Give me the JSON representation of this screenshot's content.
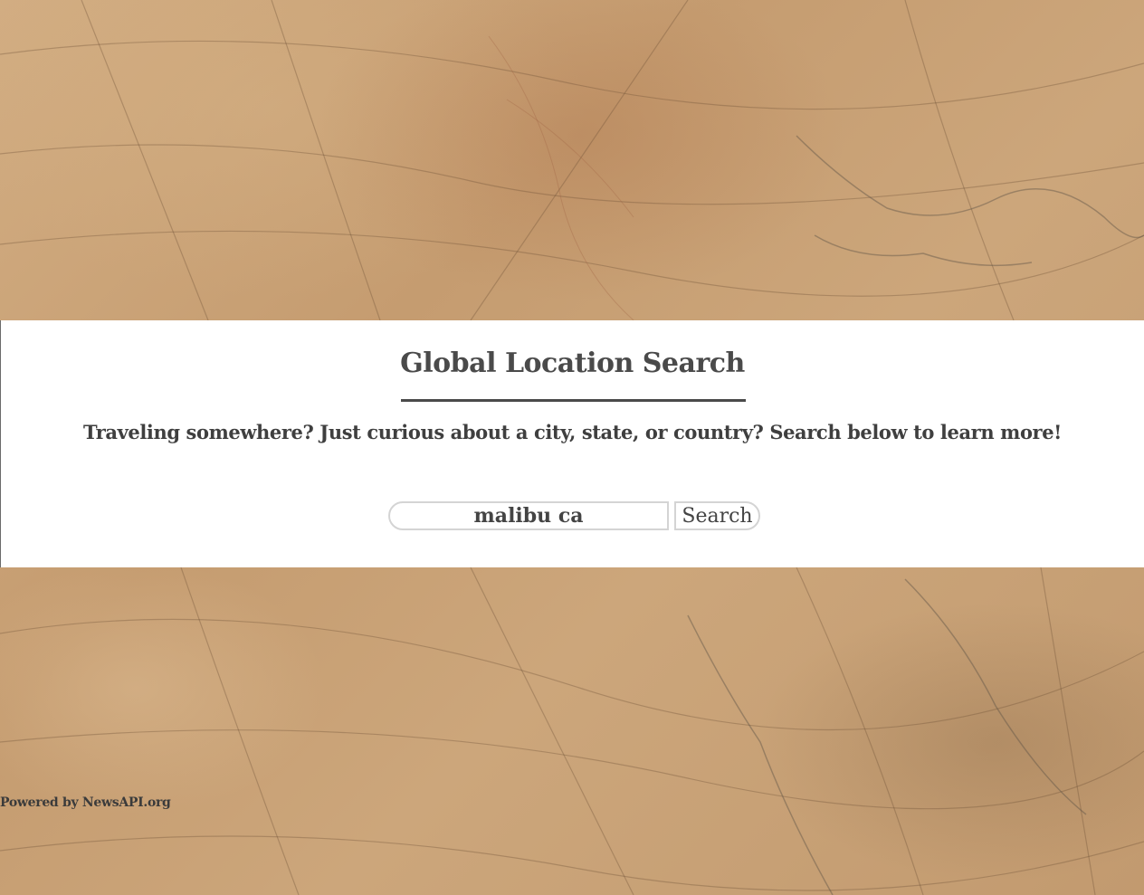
{
  "header": {
    "title": "Global Location Search",
    "subtitle": "Traveling somewhere? Just curious about a city, state, or country? Search below to learn more!"
  },
  "search": {
    "value": "malibu ca",
    "button_label": "Search"
  },
  "footer": {
    "credit": "Powered by NewsAPI.org"
  },
  "colors": {
    "background_parchment": "#c9a47a",
    "panel": "#ffffff",
    "text": "#4a4a4a"
  },
  "background": {
    "image": "antique-map-texture"
  }
}
